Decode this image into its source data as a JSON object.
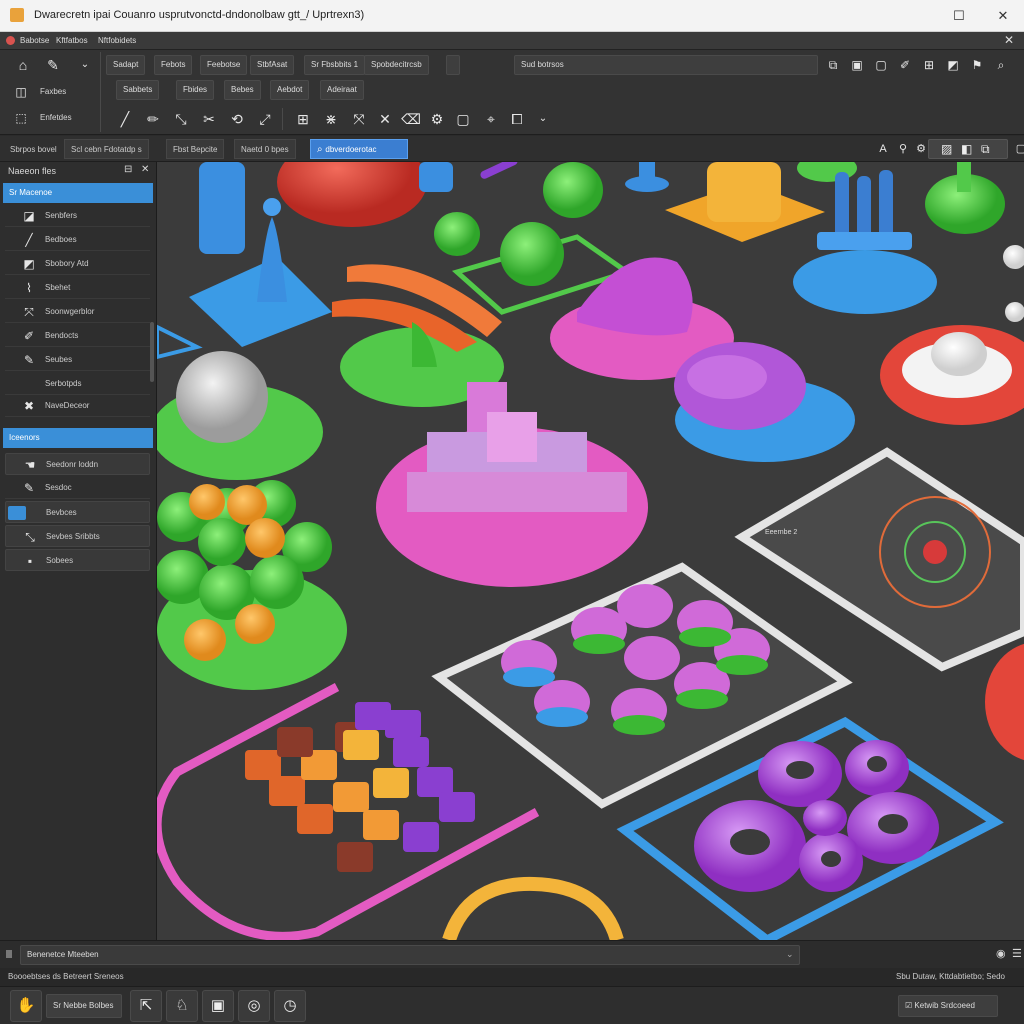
{
  "window": {
    "title": "Dwarecretn ipai Couanro usprutvonctd-dndonolbaw gtt_/ Uprtrexn3)",
    "controls": {
      "maximize": "☐",
      "close": "✕"
    },
    "menu_close": "✕"
  },
  "menubar": {
    "items": [
      "Babotse",
      "Kftfatbos",
      "Nftfobidets"
    ]
  },
  "toolbar": {
    "row1": {
      "buttons": [
        "Sadapt",
        "Febots",
        "Feebotse",
        "StbfAsat",
        "Sr Fbsbbits 1",
        "Spobdecitrcsb"
      ],
      "search": {
        "value": "Sud botrsos"
      }
    },
    "row2": {
      "buttons": [
        "Sabbets",
        "Fbides",
        "Bebes",
        "Aebdot",
        "Adeiraat"
      ]
    },
    "left_labels": [
      "Faxbes",
      "Enfetdes"
    ]
  },
  "tabs": {
    "items": [
      "Sbrpos bovel",
      "Scl cebn Fdotatdp s",
      "Fbst Bepcite",
      "Naetd 0 bpes"
    ],
    "active": "dbverdoerotac"
  },
  "panel": {
    "title": "Naeeon fles",
    "section1": {
      "title": "Sr Macenoe",
      "items": [
        "Senbfers",
        "Bedboes",
        "Sbobory Atd",
        "Sbehet",
        "Soonwgerblor",
        "Bendocts",
        "Seubes",
        "Serbotpds",
        "NaveDeceor"
      ]
    },
    "section2": {
      "title": "Iceenors",
      "items": [
        "Seedonr loddn",
        "Sesdoc",
        "Bevbces",
        "Sevbes Sribbts",
        "Sobees"
      ]
    }
  },
  "canvas": {
    "labels": {
      "board1": "Eeernbe 2"
    }
  },
  "status": {
    "search_value": "Benenetce Mteeben",
    "info_left": "Boooebtses ds Betreert Sreneos",
    "info_right": "Sbu Dutaw, Kttdabtietbo; Sedo",
    "bottom_button": "Sr Nebbe Bolbes",
    "bottom_right": "Ketwib Srdcoeed"
  },
  "colors": {
    "accent": "#3a8fd8",
    "viewport": "#3c3c3c"
  }
}
